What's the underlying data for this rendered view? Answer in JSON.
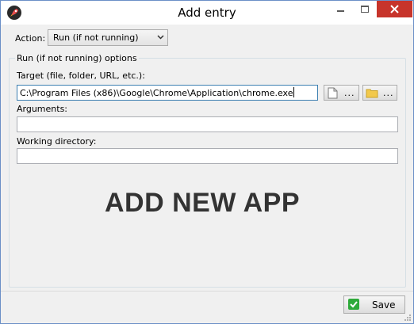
{
  "window": {
    "title": "Add entry"
  },
  "action": {
    "label": "Action:",
    "selected": "Run (if not running)"
  },
  "group": {
    "title": "Run (if not running) options"
  },
  "target": {
    "label": "Target (file, folder, URL, etc.):",
    "value": "C:\\Program Files (x86)\\Google\\Chrome\\Application\\chrome.exe",
    "browse_file_label": "...",
    "browse_folder_label": "..."
  },
  "arguments": {
    "label": "Arguments:",
    "value": ""
  },
  "working_directory": {
    "label": "Working directory:",
    "value": ""
  },
  "overlay": {
    "text": "ADD NEW APP"
  },
  "footer": {
    "save_label": "Save"
  },
  "colors": {
    "close": "#c7342b",
    "save_check": "#2eaa3a",
    "overlay_text": "#333333"
  }
}
